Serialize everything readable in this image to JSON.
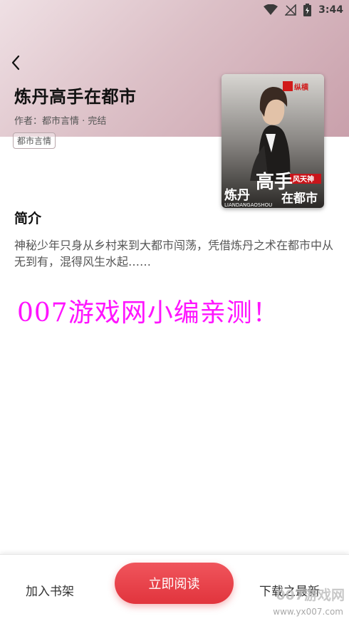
{
  "status_bar": {
    "time": "3:44"
  },
  "book": {
    "title": "炼丹高手在都市",
    "meta": "作者：都市言情 · 完结",
    "tag": "都市言情",
    "cover": {
      "publisher_text": "纵横",
      "badge_text": "风天神",
      "title_line1": "炼丹",
      "title_big": "高手",
      "title_line2": "在都市",
      "pinyin": "LIANDANGAOSHOU"
    }
  },
  "synopsis": {
    "heading": "简介",
    "text": "神秘少年只身从乡村来到大都市闯荡，凭借炼丹之术在都市中从无到有，混得风生水起……"
  },
  "overlay_watermark": "007游戏网小编亲测！",
  "bottom_bar": {
    "add_shelf": "加入书架",
    "read_now": "立即阅读",
    "download": "下载之最新"
  },
  "site_watermark": {
    "name": "007游戏网",
    "url": "www.yx007.com"
  },
  "colors": {
    "header_gradient_start": "#efe0e4",
    "header_gradient_end": "#c9a0ab",
    "accent_red": "#e1343d",
    "watermark_magenta": "#ff14ff"
  }
}
